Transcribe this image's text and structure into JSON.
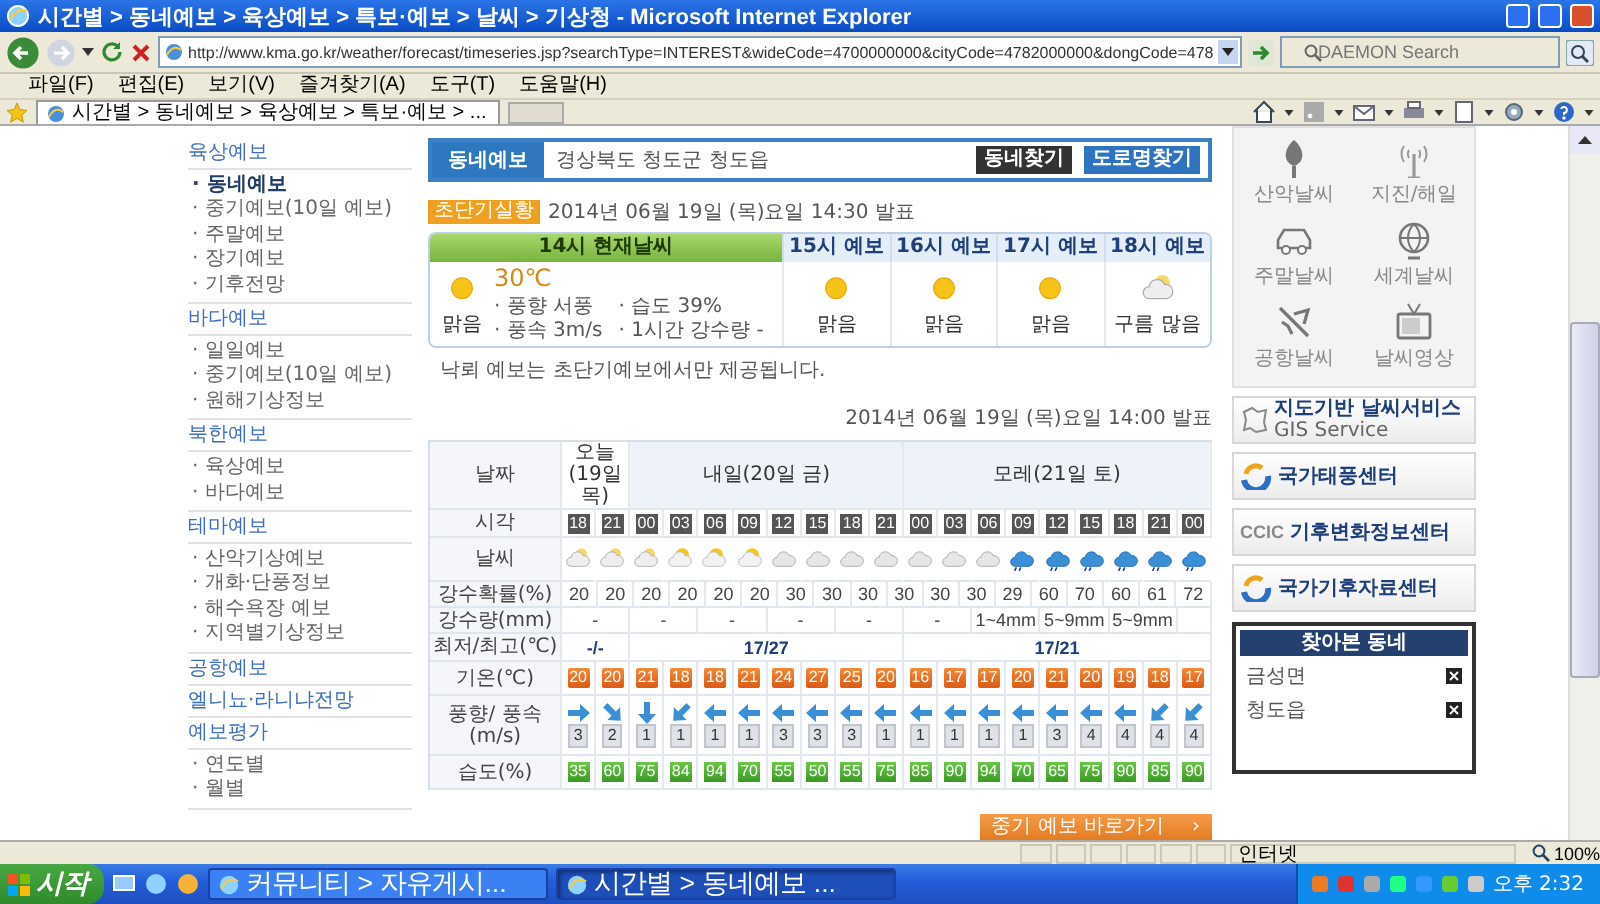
{
  "window": {
    "title": "시간별 > 동네예보 > 육상예보 > 특보·예보 > 날씨 > 기상청 - Microsoft Internet Explorer"
  },
  "address_bar": {
    "url": "http://www.kma.go.kr/weather/forecast/timeseries.jsp?searchType=INTEREST&wideCode=4700000000&cityCode=4782000000&dongCode=478",
    "search_placeholder": "DAEMON Search"
  },
  "menu_bar": [
    "파일(F)",
    "편집(E)",
    "보기(V)",
    "즐겨찾기(A)",
    "도구(T)",
    "도움말(H)"
  ],
  "tab": {
    "title": "시간별 > 동네예보 > 육상예보 > 특보·예보 > ..."
  },
  "left_nav": [
    {
      "heading": "육상예보",
      "items": [
        {
          "label": "· 동네예보",
          "selected": true
        },
        {
          "label": "· 중기예보(10일 예보)",
          "selected": false
        },
        {
          "label": "· 주말예보",
          "selected": false
        },
        {
          "label": "· 장기예보",
          "selected": false
        },
        {
          "label": "· 기후전망",
          "selected": false
        }
      ]
    },
    {
      "heading": "바다예보",
      "items": [
        {
          "label": "· 일일예보",
          "selected": false
        },
        {
          "label": "· 중기예보(10일 예보)",
          "selected": false
        },
        {
          "label": "· 원해기상정보",
          "selected": false
        }
      ]
    },
    {
      "heading": "북한예보",
      "items": [
        {
          "label": "· 육상예보",
          "selected": false
        },
        {
          "label": "· 바다예보",
          "selected": false
        }
      ]
    },
    {
      "heading": "테마예보",
      "items": [
        {
          "label": "· 산악기상예보",
          "selected": false
        },
        {
          "label": "· 개화·단풍정보",
          "selected": false
        },
        {
          "label": "· 해수욕장 예보",
          "selected": false
        },
        {
          "label": "· 지역별기상정보",
          "selected": false
        }
      ]
    },
    {
      "heading": "공항예보"
    },
    {
      "heading": "엘니뇨·라니냐전망"
    },
    {
      "heading": "예보평가",
      "items": [
        {
          "label": "· 연도별",
          "selected": false
        },
        {
          "label": "· 월별",
          "selected": false
        }
      ]
    }
  ],
  "location": {
    "label": "동네예보",
    "value": "경상북도 청도군 청도읍",
    "buttons": [
      {
        "label": "동네찾기",
        "kind": "dark"
      },
      {
        "label": "도로명찾기",
        "kind": "blue"
      }
    ]
  },
  "current": {
    "badge": "초단기실황",
    "issued": "2014년 06월 19일 (목)요일 14:30 발표",
    "now": {
      "header": "14시 현재날씨",
      "kind": "sunny",
      "condition": "맑음",
      "temperature": "30℃",
      "details": [
        "· 풍향 서풍",
        "· 습도 39%",
        "· 풍속 3m/s",
        "· 1시간 강수량 -"
      ]
    },
    "forecasts": [
      {
        "header": "15시 예보",
        "kind": "sunny",
        "condition": "맑음"
      },
      {
        "header": "16시 예보",
        "kind": "sunny",
        "condition": "맑음"
      },
      {
        "header": "17시 예보",
        "kind": "sunny",
        "condition": "맑음"
      },
      {
        "header": "18시 예보",
        "kind": "mostly_cloudy",
        "condition": "구름 많음"
      }
    ],
    "note": "낙뢰 예보는 초단기예보에서만 제공됩니다."
  },
  "timeseries": {
    "issued": "2014년 06월 19일 (목)요일 14:00 발표",
    "row_labels": [
      "날짜",
      "시각",
      "날씨",
      "강수확률(%)",
      "강수량(mm)",
      "최저/최고(℃)",
      "기온(℃)",
      "풍향/ 풍속(m/s)",
      "습도(%)"
    ],
    "days": [
      {
        "label": "오늘 (19일 목)",
        "minmax": "-/-",
        "columns": [
          {
            "time": "18",
            "weather": {
              "kind": "mostly_cloudy"
            },
            "temp": "20",
            "wind": {
              "kind": "W",
              "speed": "3"
            },
            "humidity": "35"
          },
          {
            "time": "21",
            "weather": {
              "kind": "mostly_cloudy"
            },
            "temp": "20",
            "wind": {
              "kind": "NW",
              "speed": "2"
            },
            "humidity": "60"
          }
        ]
      },
      {
        "label": "내일(20일 금)",
        "minmax": "17/27",
        "columns": [
          {
            "time": "00",
            "weather": {
              "kind": "mostly_cloudy"
            },
            "temp": "21",
            "wind": {
              "kind": "N",
              "speed": "1"
            },
            "humidity": "75"
          },
          {
            "time": "03",
            "weather": {
              "kind": "partly_cloudy"
            },
            "temp": "18",
            "wind": {
              "kind": "NE",
              "speed": "1"
            },
            "humidity": "84"
          },
          {
            "time": "06",
            "weather": {
              "kind": "partly_cloudy"
            },
            "temp": "18",
            "wind": {
              "kind": "E",
              "speed": "1"
            },
            "humidity": "94"
          },
          {
            "time": "09",
            "weather": {
              "kind": "partly_cloudy"
            },
            "temp": "21",
            "wind": {
              "kind": "E",
              "speed": "1"
            },
            "humidity": "70"
          },
          {
            "time": "12",
            "weather": {
              "kind": "cloudy"
            },
            "temp": "24",
            "wind": {
              "kind": "E",
              "speed": "3"
            },
            "humidity": "55"
          },
          {
            "time": "15",
            "weather": {
              "kind": "cloudy"
            },
            "temp": "27",
            "wind": {
              "kind": "E",
              "speed": "3"
            },
            "humidity": "50"
          },
          {
            "time": "18",
            "weather": {
              "kind": "cloudy"
            },
            "temp": "25",
            "wind": {
              "kind": "E",
              "speed": "3"
            },
            "humidity": "55"
          },
          {
            "time": "21",
            "weather": {
              "kind": "cloudy"
            },
            "temp": "20",
            "wind": {
              "kind": "E",
              "speed": "1"
            },
            "humidity": "75"
          }
        ]
      },
      {
        "label": "모레(21일 토)",
        "minmax": "17/21",
        "columns": [
          {
            "time": "00",
            "weather": {
              "kind": "cloudy"
            },
            "temp": "16",
            "wind": {
              "kind": "E",
              "speed": "1"
            },
            "humidity": "85"
          },
          {
            "time": "03",
            "weather": {
              "kind": "cloudy"
            },
            "temp": "17",
            "wind": {
              "kind": "E",
              "speed": "1"
            },
            "humidity": "90"
          },
          {
            "time": "06",
            "weather": {
              "kind": "cloudy"
            },
            "temp": "17",
            "wind": {
              "kind": "E",
              "speed": "1"
            },
            "humidity": "94"
          },
          {
            "time": "09",
            "weather": {
              "kind": "rain"
            },
            "temp": "20",
            "wind": {
              "kind": "E",
              "speed": "1"
            },
            "humidity": "70"
          },
          {
            "time": "12",
            "weather": {
              "kind": "rain"
            },
            "temp": "21",
            "wind": {
              "kind": "E",
              "speed": "3"
            },
            "humidity": "65"
          },
          {
            "time": "15",
            "weather": {
              "kind": "rain"
            },
            "temp": "20",
            "wind": {
              "kind": "E",
              "speed": "4"
            },
            "humidity": "75"
          },
          {
            "time": "18",
            "weather": {
              "kind": "rain"
            },
            "temp": "19",
            "wind": {
              "kind": "E",
              "speed": "4"
            },
            "humidity": "90"
          },
          {
            "time": "21",
            "weather": {
              "kind": "rain"
            },
            "temp": "18",
            "wind": {
              "kind": "NE",
              "speed": "4"
            },
            "humidity": "85"
          },
          {
            "time": "00",
            "weather": {
              "kind": "rain"
            },
            "temp": "17",
            "wind": {
              "kind": "NE",
              "speed": "4"
            },
            "humidity": "90"
          }
        ]
      }
    ],
    "precip_prob": [
      "20",
      "20",
      "20",
      "20",
      "20",
      "20",
      "30",
      "30",
      "30",
      "30",
      "30",
      "30",
      "29",
      "60",
      "70",
      "60",
      "61",
      "72"
    ],
    "precip_amount": [
      "-",
      "-",
      "-",
      "-",
      "-",
      "-",
      "1~4mm",
      "5~9mm",
      "5~9mm"
    ]
  },
  "more_button": {
    "label": "중기 예보 바로가기",
    "arrow": "›"
  },
  "quick_links": [
    {
      "label": "산악날씨",
      "kind": "tree"
    },
    {
      "label": "지진/해일",
      "kind": "antenna"
    },
    {
      "label": "주말날씨",
      "kind": "car"
    },
    {
      "label": "세계날씨",
      "kind": "globe"
    },
    {
      "label": "공항날씨",
      "kind": "plane"
    },
    {
      "label": "날씨영상",
      "kind": "tv"
    }
  ],
  "banners": [
    {
      "kind": "gis",
      "text": "지도기반 날씨서비스",
      "sub": "GIS Service"
    },
    {
      "kind": "swirl",
      "text": "국가태풍센터"
    },
    {
      "kind": "ccic",
      "logo": "CCIC",
      "text": "기후변화정보센터"
    },
    {
      "kind": "swirl",
      "text": "국가기후자료센터"
    }
  ],
  "recent": {
    "title": "찾아본 동네",
    "items": [
      "금성면",
      "청도읍"
    ]
  },
  "status_bar": {
    "zone": "인터넷",
    "zoom": "100%"
  },
  "taskbar": {
    "start": "시작",
    "tasks": [
      {
        "label": "커뮤니티 > 자유게시...",
        "selected": false
      },
      {
        "label": "시간별 > 동네예보 ...",
        "selected": true
      }
    ],
    "clock": "오후 2:32"
  }
}
